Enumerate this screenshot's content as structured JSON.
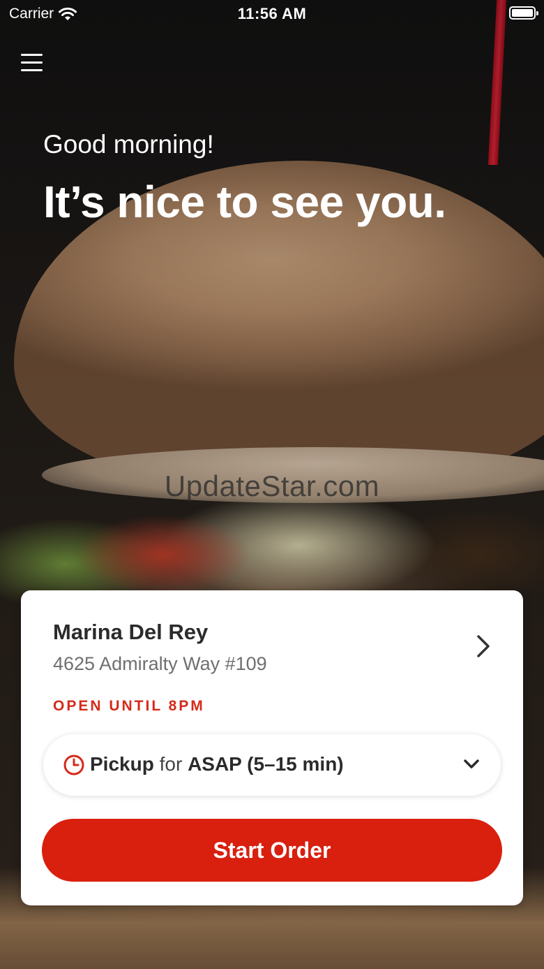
{
  "status_bar": {
    "carrier": "Carrier",
    "time": "11:56 AM"
  },
  "header": {
    "menu_icon": "hamburger-menu-icon"
  },
  "hero": {
    "greeting": "Good morning!",
    "tagline": "It’s nice to see you."
  },
  "watermark": "UpdateStar.com",
  "store_card": {
    "name": "Marina Del Rey",
    "address": "4625 Admiralty Way #109",
    "hours_status": "OPEN UNTIL 8PM",
    "pickup": {
      "mode": "Pickup",
      "connector": "for",
      "time": "ASAP (5–15 min)"
    },
    "start_button": "Start Order"
  },
  "colors": {
    "accent": "#d91f0e",
    "status_red": "#d52a1a",
    "card_bg": "#ffffff",
    "text_dark": "#2b2b2b",
    "text_muted": "#6f6f6f"
  }
}
